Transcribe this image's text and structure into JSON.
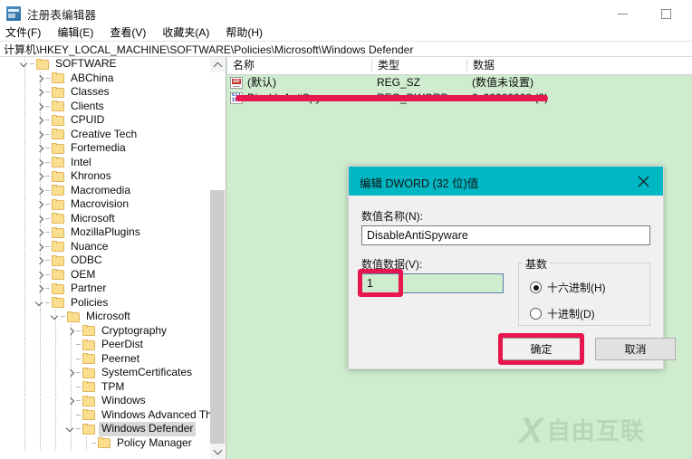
{
  "window": {
    "title": "注册表编辑器",
    "icon": "registry-editor-icon",
    "minimize_label": "最小化",
    "maximize_label": "最大化"
  },
  "menu": {
    "items": [
      {
        "label": "文件(F)"
      },
      {
        "label": "编辑(E)"
      },
      {
        "label": "查看(V)"
      },
      {
        "label": "收藏夹(A)"
      },
      {
        "label": "帮助(H)"
      }
    ]
  },
  "address": {
    "path": "计算机\\HKEY_LOCAL_MACHINE\\SOFTWARE\\Policies\\Microsoft\\Windows Defender"
  },
  "tree": {
    "items": [
      {
        "label": "SOFTWARE",
        "depth": 1,
        "state": "open",
        "selected": false
      },
      {
        "label": "ABChina",
        "depth": 2,
        "state": "closed",
        "selected": false
      },
      {
        "label": "Classes",
        "depth": 2,
        "state": "closed",
        "selected": false
      },
      {
        "label": "Clients",
        "depth": 2,
        "state": "closed",
        "selected": false
      },
      {
        "label": "CPUID",
        "depth": 2,
        "state": "closed",
        "selected": false
      },
      {
        "label": "Creative Tech",
        "depth": 2,
        "state": "closed",
        "selected": false
      },
      {
        "label": "Fortemedia",
        "depth": 2,
        "state": "closed",
        "selected": false
      },
      {
        "label": "Intel",
        "depth": 2,
        "state": "closed",
        "selected": false
      },
      {
        "label": "Khronos",
        "depth": 2,
        "state": "closed",
        "selected": false
      },
      {
        "label": "Macromedia",
        "depth": 2,
        "state": "closed",
        "selected": false
      },
      {
        "label": "Macrovision",
        "depth": 2,
        "state": "closed",
        "selected": false
      },
      {
        "label": "Microsoft",
        "depth": 2,
        "state": "closed",
        "selected": false
      },
      {
        "label": "MozillaPlugins",
        "depth": 2,
        "state": "closed",
        "selected": false
      },
      {
        "label": "Nuance",
        "depth": 2,
        "state": "closed",
        "selected": false
      },
      {
        "label": "ODBC",
        "depth": 2,
        "state": "closed",
        "selected": false
      },
      {
        "label": "OEM",
        "depth": 2,
        "state": "closed",
        "selected": false
      },
      {
        "label": "Partner",
        "depth": 2,
        "state": "closed",
        "selected": false
      },
      {
        "label": "Policies",
        "depth": 2,
        "state": "open",
        "selected": false
      },
      {
        "label": "Microsoft",
        "depth": 3,
        "state": "open",
        "selected": false
      },
      {
        "label": "Cryptography",
        "depth": 4,
        "state": "closed",
        "selected": false
      },
      {
        "label": "PeerDist",
        "depth": 4,
        "state": "leaf",
        "selected": false
      },
      {
        "label": "Peernet",
        "depth": 4,
        "state": "leaf",
        "selected": false
      },
      {
        "label": "SystemCertificates",
        "depth": 4,
        "state": "closed",
        "selected": false
      },
      {
        "label": "TPM",
        "depth": 4,
        "state": "leaf",
        "selected": false
      },
      {
        "label": "Windows",
        "depth": 4,
        "state": "closed",
        "selected": false
      },
      {
        "label": "Windows Advanced Th",
        "depth": 4,
        "state": "leaf",
        "selected": false
      },
      {
        "label": "Windows Defender",
        "depth": 4,
        "state": "open",
        "selected": true
      },
      {
        "label": "Policy Manager",
        "depth": 5,
        "state": "leaf",
        "selected": false
      }
    ],
    "scrollbar": {
      "up_arrow": "chevron-up-icon",
      "down_arrow": "chevron-down-icon"
    }
  },
  "list": {
    "columns": [
      {
        "label": "名称"
      },
      {
        "label": "类型"
      },
      {
        "label": "数据"
      }
    ],
    "rows": [
      {
        "icon": "string-value-icon",
        "icon_kind": "sz",
        "name": "(默认)",
        "type": "REG_SZ",
        "data": "(数值未设置)"
      },
      {
        "icon": "dword-value-icon",
        "icon_kind": "dw",
        "name": "DisableAntiSpyware",
        "type": "REG_DWORD",
        "data": "0x00000000 (0)"
      }
    ]
  },
  "dialog": {
    "title": "编辑 DWORD (32 位)值",
    "close_icon": "close-icon",
    "value_name_label": "数值名称(N):",
    "value_name": "DisableAntiSpyware",
    "value_data_label": "数值数据(V):",
    "value_data": "1",
    "base_group_label": "基数",
    "radio_hex_label": "十六进制(H)",
    "radio_dec_label": "十进制(D)",
    "radio_selected": "hex",
    "ok_label": "确定",
    "cancel_label": "取消"
  },
  "annotations": {
    "accent_color": "#e8164f",
    "row_underline": "highlight-bar-disableantispyware",
    "data_box": "highlight-box-value-data",
    "ok_box": "highlight-box-ok-button"
  },
  "watermark": {
    "logo": "X",
    "text": "自由互联",
    "color": "#3a6e3a"
  }
}
